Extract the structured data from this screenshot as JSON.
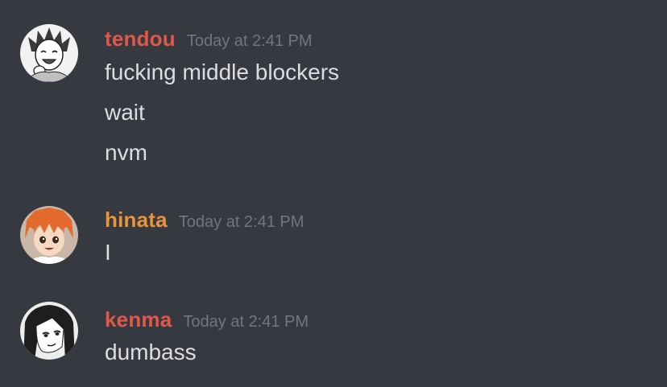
{
  "messages": [
    {
      "username": "tendou",
      "username_color": "#e0584a",
      "timestamp": "Today at 2:41 PM",
      "avatar_icon": "tendou-avatar-icon",
      "lines": [
        "fucking middle blockers",
        "wait",
        "nvm"
      ]
    },
    {
      "username": "hinata",
      "username_color": "#e8943a",
      "timestamp": "Today at 2:41 PM",
      "avatar_icon": "hinata-avatar-icon",
      "lines": [
        "I"
      ]
    },
    {
      "username": "kenma",
      "username_color": "#e0584a",
      "timestamp": "Today at 2:41 PM",
      "avatar_icon": "kenma-avatar-icon",
      "lines": [
        "dumbass"
      ]
    }
  ]
}
